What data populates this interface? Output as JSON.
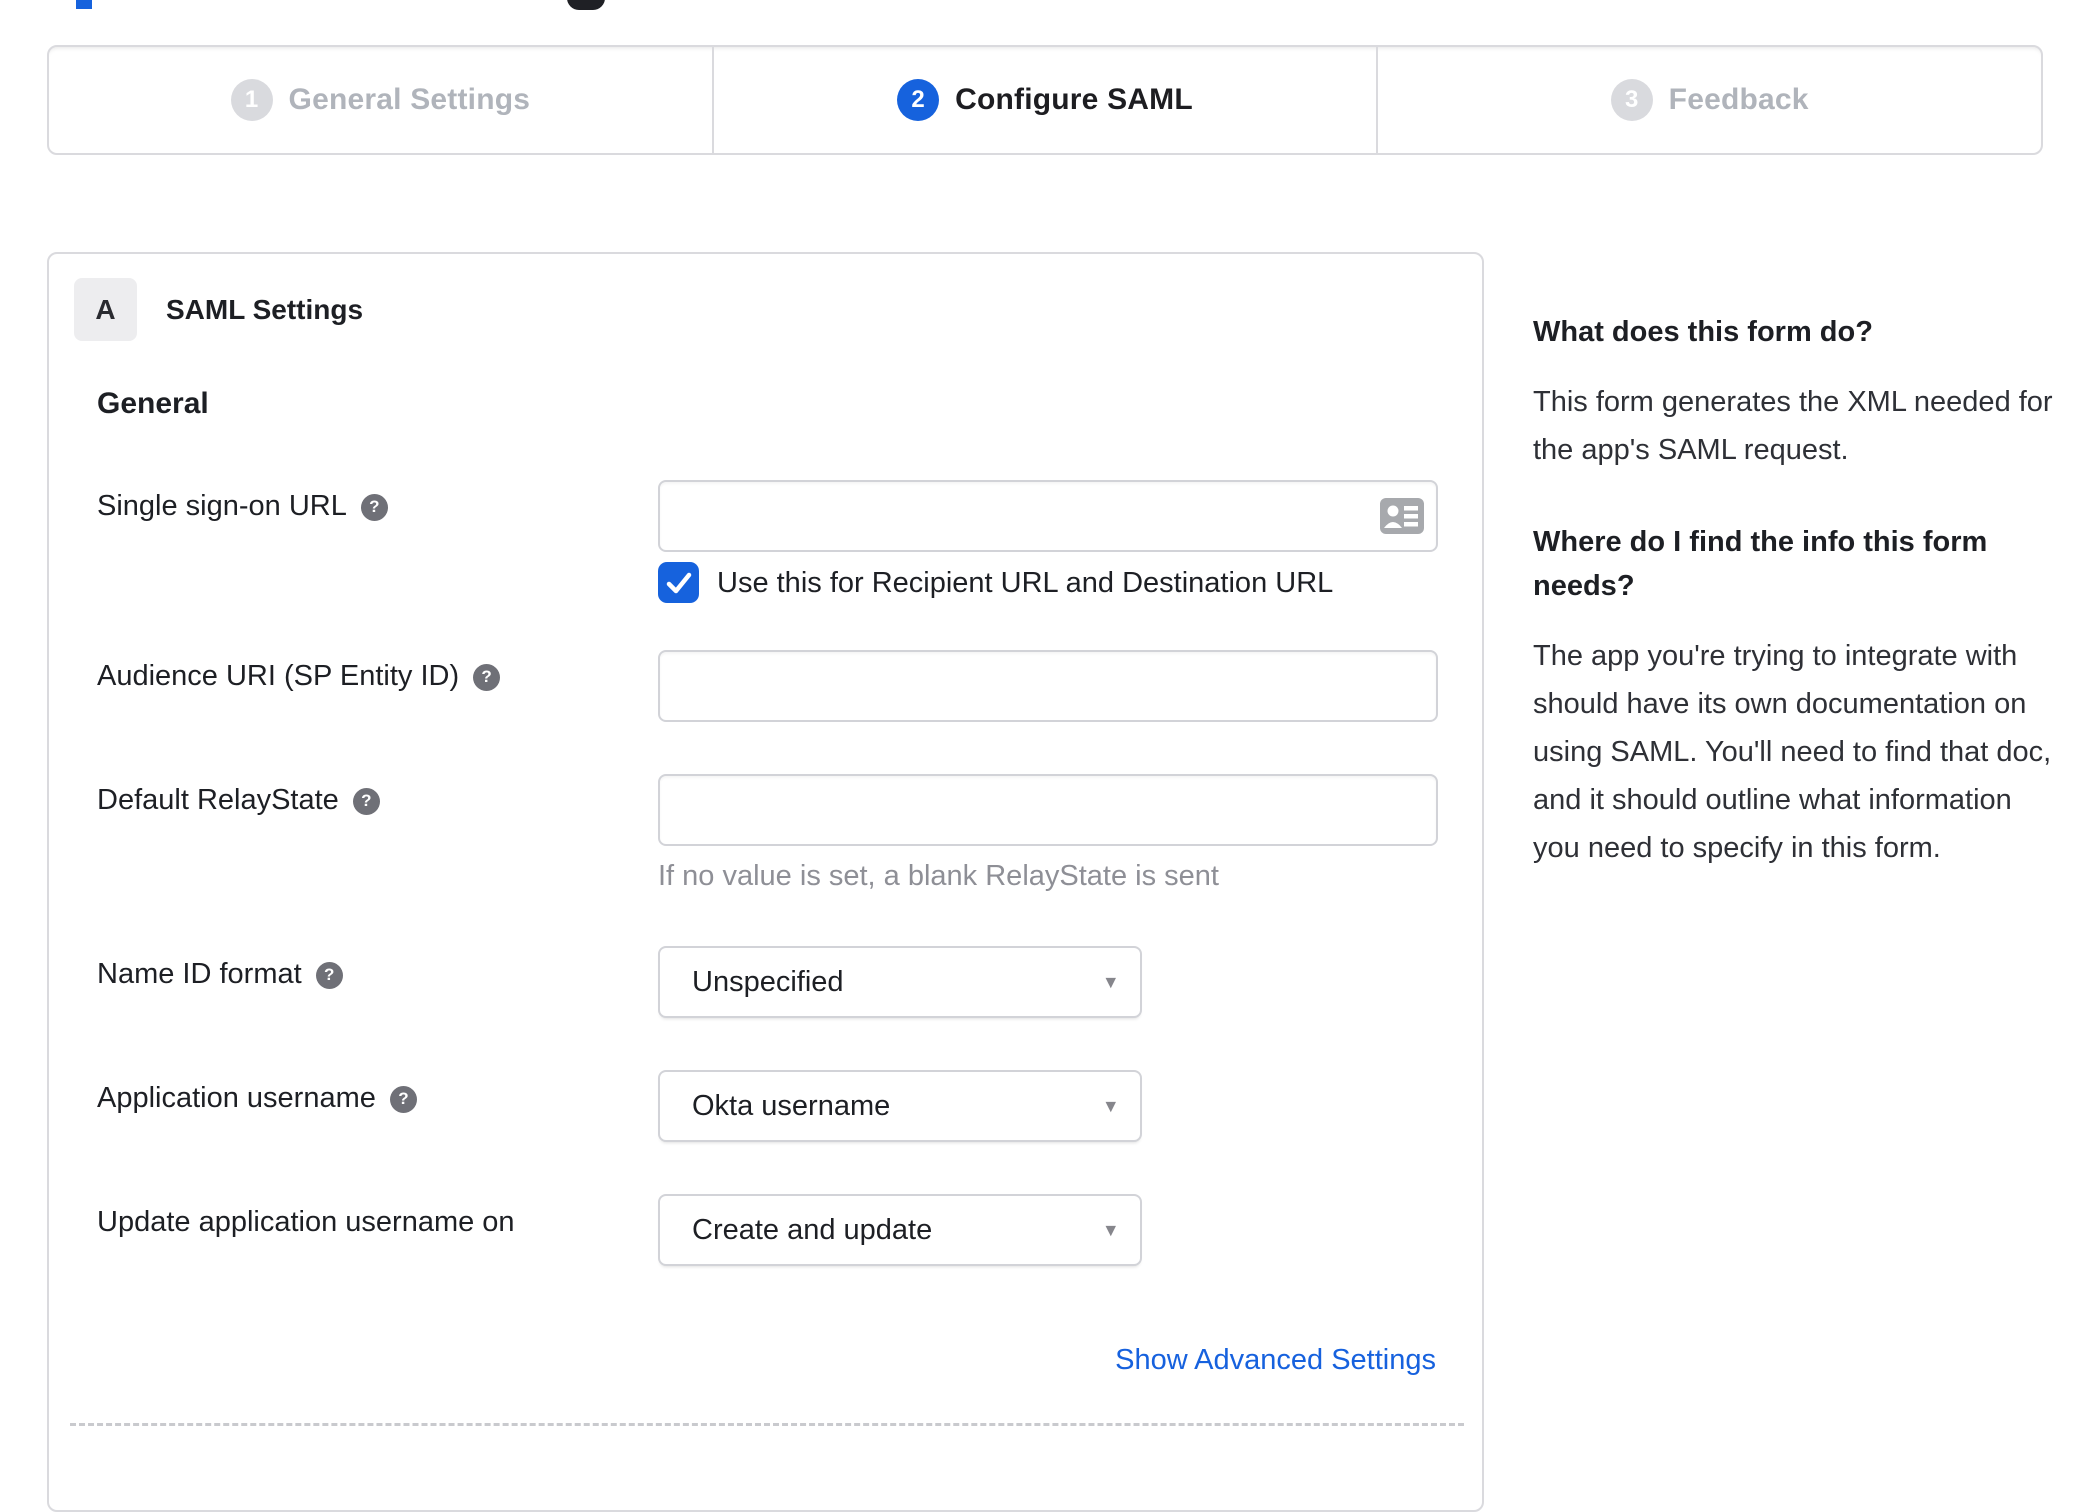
{
  "stepper": {
    "steps": [
      {
        "number": "1",
        "label": "General Settings",
        "state": "inactive"
      },
      {
        "number": "2",
        "label": "Configure SAML",
        "state": "active"
      },
      {
        "number": "3",
        "label": "Feedback",
        "state": "inactive"
      }
    ]
  },
  "panel": {
    "section_badge": "A",
    "section_title": "SAML Settings",
    "group_heading": "General",
    "fields": {
      "sso_url": {
        "label": "Single sign-on URL",
        "value": "",
        "checkbox_label": "Use this for Recipient URL and Destination URL",
        "checkbox_checked": true
      },
      "audience_uri": {
        "label": "Audience URI (SP Entity ID)",
        "value": ""
      },
      "default_relaystate": {
        "label": "Default RelayState",
        "value": "",
        "hint": "If no value is set, a blank RelayState is sent"
      },
      "name_id_format": {
        "label": "Name ID format",
        "value": "Unspecified"
      },
      "application_username": {
        "label": "Application username",
        "value": "Okta username"
      },
      "update_app_username": {
        "label": "Update application username on",
        "value": "Create and update"
      }
    },
    "advanced_link": "Show Advanced Settings"
  },
  "sidebar": {
    "section1": {
      "heading": "What does this form do?",
      "body": "This form generates the XML needed for the app's SAML request."
    },
    "section2": {
      "heading": "Where do I find the info this form needs?",
      "body": "The app you're trying to integrate with should have its own documentation on using SAML. You'll need to find that doc, and it should outline what information you need to specify in this form."
    }
  },
  "icons": {
    "help": "?",
    "select_arrow": "▾"
  },
  "colors": {
    "accent_blue": "#1662dd",
    "inactive_gray": "#d9dade",
    "border_gray": "#dadade",
    "hint_gray": "#8e8f96",
    "link_blue": "#1661de"
  }
}
